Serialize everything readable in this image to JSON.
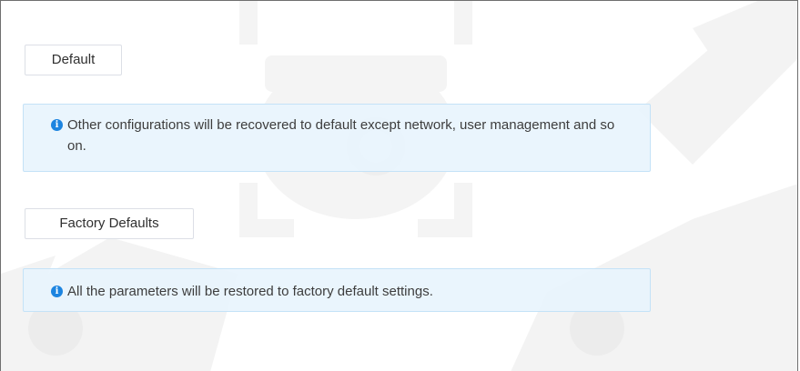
{
  "panel": {
    "default_button_label": "Default",
    "default_notice": "Other configurations will be recovered to default except network, user management and so on.",
    "factory_button_label": "Factory Defaults",
    "factory_notice": "All the parameters will be restored to factory default settings."
  },
  "icons": {
    "notice_icon": "info-circle-icon",
    "notice_icon_glyph": "i"
  },
  "colors": {
    "info_blue": "#1c84e0",
    "notice_background": "#e8f4fd",
    "notice_border": "#c4e2f7"
  }
}
